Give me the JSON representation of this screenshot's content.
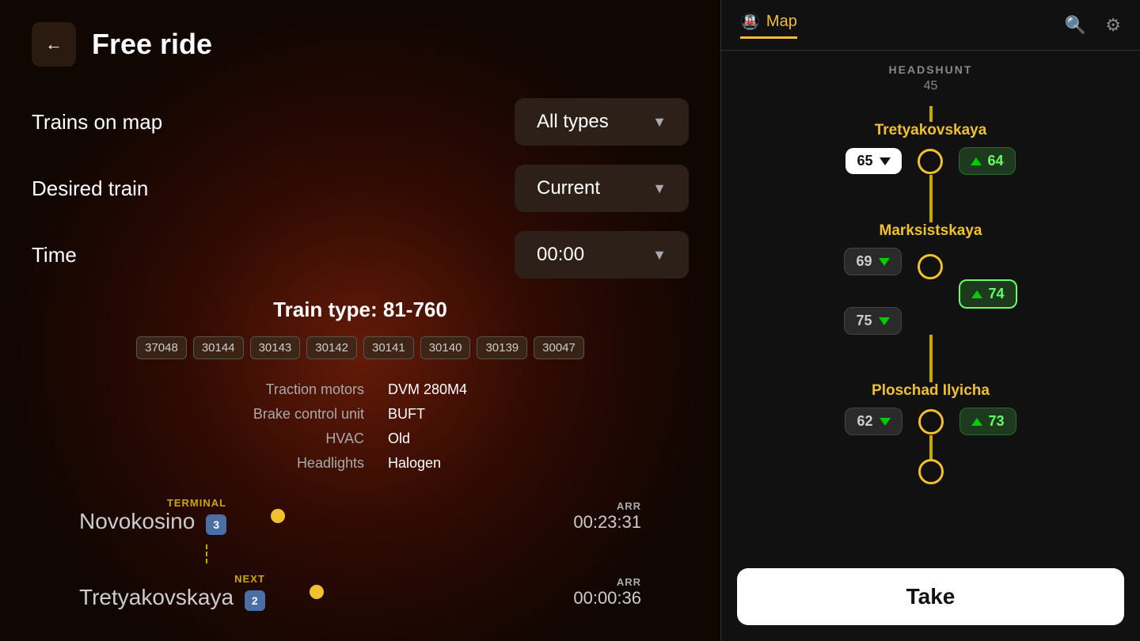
{
  "header": {
    "back_label": "←",
    "title": "Free ride"
  },
  "form": {
    "trains_label": "Trains on map",
    "trains_value": "All types",
    "desired_label": "Desired train",
    "desired_value": "Current",
    "time_label": "Time",
    "time_value": "00:00"
  },
  "train": {
    "type_label": "Train type: 81-760",
    "car_numbers": [
      "37048",
      "30144",
      "30143",
      "30142",
      "30141",
      "30140",
      "30139",
      "30047"
    ],
    "specs": [
      {
        "key": "Traction motors",
        "value": "DVM 280M4"
      },
      {
        "key": "Brake control unit",
        "value": "BUFT"
      },
      {
        "key": "HVAC",
        "value": "Old"
      },
      {
        "key": "Headlights",
        "value": "Halogen"
      }
    ]
  },
  "journey": [
    {
      "tag": "TERMINAL",
      "station": "Novokosino",
      "badge": "3",
      "arr_label": "ARR",
      "arr_time": "00:23:31"
    },
    {
      "tag": "NEXT",
      "station": "Tretyakovskaya",
      "badge": "2",
      "arr_label": "ARR",
      "arr_time": "00:00:36"
    }
  ],
  "map": {
    "nav": {
      "map_label": "Map",
      "search_icon": "🔍",
      "gear_icon": "⚙"
    },
    "headshunt": "HEADSHUNT",
    "headshunt_num": "45",
    "stations": [
      {
        "name": "Tretyakovskaya",
        "left_chip": {
          "num": "65",
          "dir": "down",
          "active": true
        },
        "right_chip": {
          "num": "64",
          "dir": "up",
          "active": false
        },
        "has_circle": true
      },
      {
        "name": "Marksistskaya",
        "left_chip_top": {
          "num": "69",
          "dir": "down",
          "active": false
        },
        "left_chip_bot": {
          "num": "75",
          "dir": "down",
          "active": false
        },
        "right_chip": {
          "num": "74",
          "dir": "up",
          "active": true
        },
        "has_circle": true
      },
      {
        "name": "Ploschad Ilyicha",
        "left_chip": {
          "num": "62",
          "dir": "down",
          "active": false
        },
        "right_chip": {
          "num": "73",
          "dir": "up",
          "active": false
        },
        "has_circle": true
      }
    ],
    "take_label": "Take"
  }
}
